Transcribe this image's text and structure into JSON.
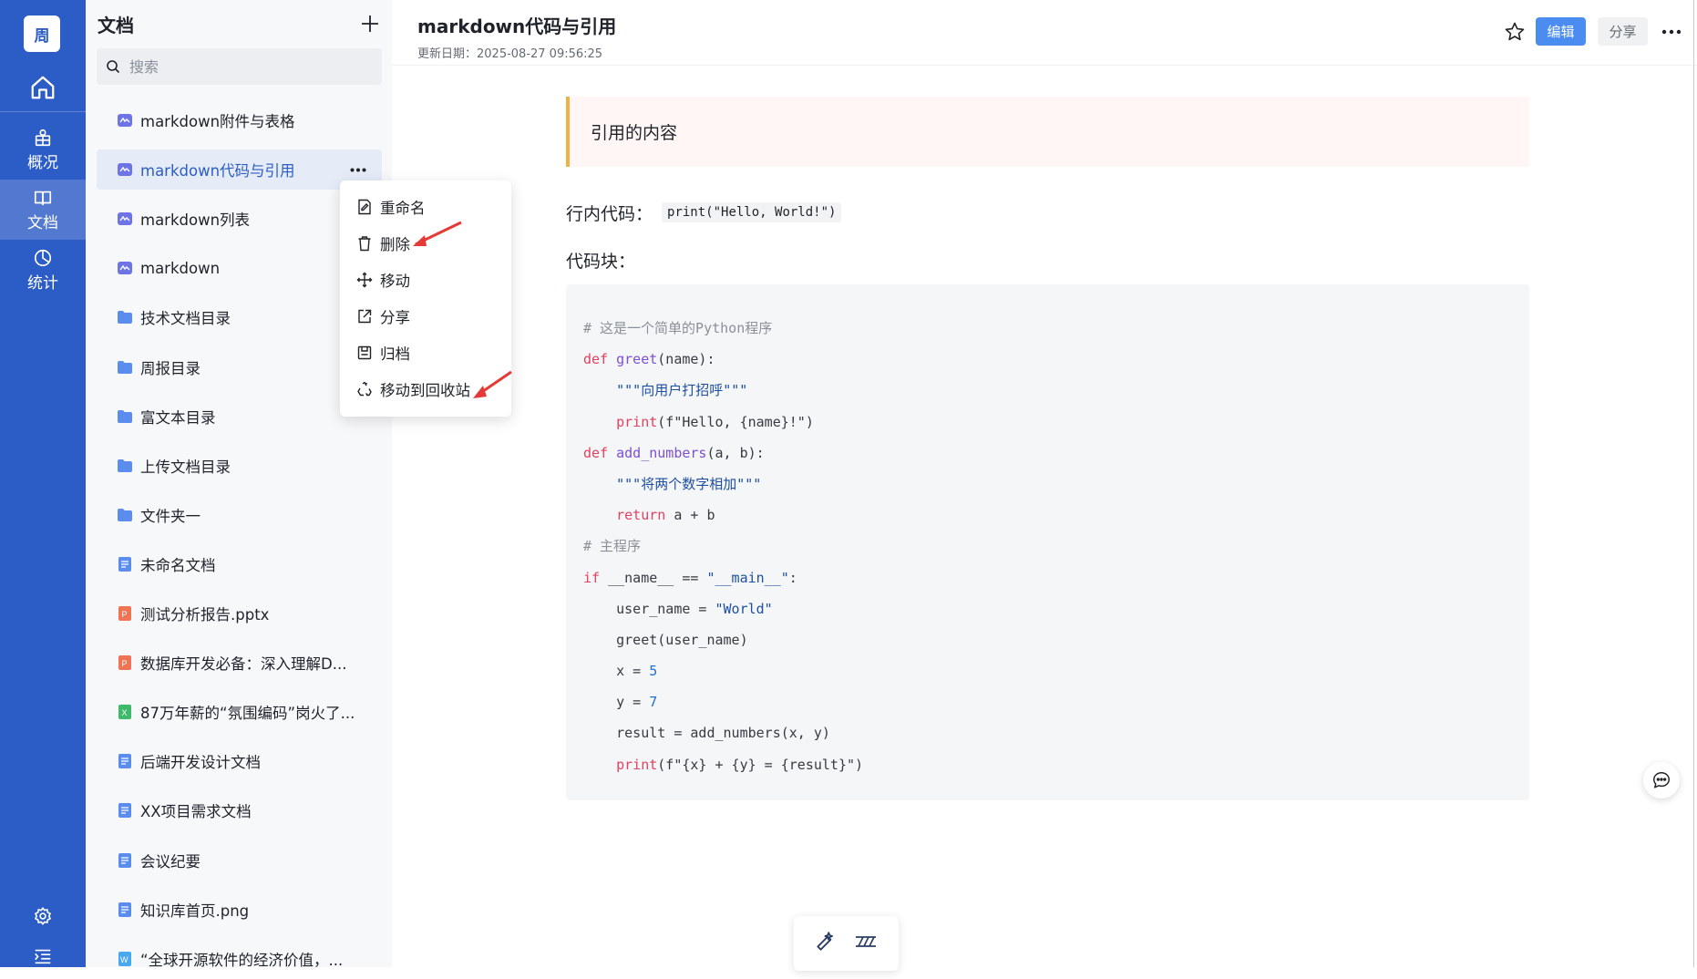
{
  "rail": {
    "avatar": "周",
    "items": [
      {
        "label": "概况"
      },
      {
        "label": "文档"
      },
      {
        "label": "统计"
      }
    ]
  },
  "sidebar": {
    "title": "文档",
    "search_placeholder": "搜索",
    "items": [
      {
        "label": "markdown附件与表格",
        "icon": "markdown-doc-icon"
      },
      {
        "label": "markdown代码与引用",
        "icon": "markdown-doc-icon"
      },
      {
        "label": "markdown列表",
        "icon": "markdown-doc-icon"
      },
      {
        "label": "markdown",
        "icon": "markdown-doc-icon"
      },
      {
        "label": "技术文档目录",
        "icon": "folder-icon"
      },
      {
        "label": "周报目录",
        "icon": "folder-icon"
      },
      {
        "label": "富文本目录",
        "icon": "folder-icon"
      },
      {
        "label": "上传文档目录",
        "icon": "folder-icon"
      },
      {
        "label": "文件夹一",
        "icon": "folder-icon"
      },
      {
        "label": "未命名文档",
        "icon": "doc-icon"
      },
      {
        "label": "测试分析报告.pptx",
        "icon": "ppt-icon"
      },
      {
        "label": "数据库开发必备：深入理解D...",
        "icon": "ppt-icon"
      },
      {
        "label": "87万年薪的“氛围编码”岗火了...",
        "icon": "excel-icon"
      },
      {
        "label": "后端开发设计文档",
        "icon": "doc-icon"
      },
      {
        "label": "XX项目需求文档",
        "icon": "doc-icon"
      },
      {
        "label": "会议纪要",
        "icon": "doc-icon"
      },
      {
        "label": "知识库首页.png",
        "icon": "doc-icon"
      },
      {
        "label": "“全球开源软件的经济价值，...",
        "icon": "word-icon"
      }
    ]
  },
  "context_menu": {
    "items": [
      {
        "label": "重命名",
        "icon": "rename-icon"
      },
      {
        "label": "删除",
        "icon": "trash-icon"
      },
      {
        "label": "移动",
        "icon": "move-icon"
      },
      {
        "label": "分享",
        "icon": "share-icon"
      },
      {
        "label": "归档",
        "icon": "archive-icon"
      },
      {
        "label": "移动到回收站",
        "icon": "recycle-icon"
      }
    ]
  },
  "header": {
    "title": "markdown代码与引用",
    "date": "更新日期：2025-08-27 09:56:25",
    "edit_label": "编辑",
    "share_label": "分享"
  },
  "content": {
    "quote": "引用的内容",
    "inline_label": "行内代码：",
    "inline_code": "print(\"Hello, World!\")",
    "block_label": "代码块：",
    "code_lines": [
      [
        {
          "t": "# 这是一个简单的Python程序",
          "c": "cm"
        }
      ],
      [
        {
          "t": "def ",
          "c": "kw"
        },
        {
          "t": "greet",
          "c": "fn"
        },
        {
          "t": "(name):",
          "c": ""
        }
      ],
      [
        {
          "t": "    \"\"\"向用户打招呼\"\"\"",
          "c": "st"
        }
      ],
      [
        {
          "t": "    ",
          "c": ""
        },
        {
          "t": "print",
          "c": "kw"
        },
        {
          "t": "(f\"Hello, {name}!\")",
          "c": ""
        }
      ],
      [
        {
          "t": "def ",
          "c": "kw"
        },
        {
          "t": "add_numbers",
          "c": "fn"
        },
        {
          "t": "(a, b):",
          "c": ""
        }
      ],
      [
        {
          "t": "    \"\"\"将两个数字相加\"\"\"",
          "c": "st"
        }
      ],
      [
        {
          "t": "    ",
          "c": ""
        },
        {
          "t": "return",
          "c": "kw"
        },
        {
          "t": " a + b",
          "c": ""
        }
      ],
      [
        {
          "t": "# 主程序",
          "c": "cm"
        }
      ],
      [
        {
          "t": "if",
          "c": "kw"
        },
        {
          "t": " __name__ == ",
          "c": ""
        },
        {
          "t": "\"__main__\"",
          "c": "st"
        },
        {
          "t": ":",
          "c": ""
        }
      ],
      [
        {
          "t": "    user_name = ",
          "c": ""
        },
        {
          "t": "\"World\"",
          "c": "st"
        }
      ],
      [
        {
          "t": "    greet(user_name)",
          "c": ""
        }
      ],
      [
        {
          "t": "    x = ",
          "c": ""
        },
        {
          "t": "5",
          "c": "nm"
        }
      ],
      [
        {
          "t": "    y = ",
          "c": ""
        },
        {
          "t": "7",
          "c": "nm"
        }
      ],
      [
        {
          "t": "    result = add_numbers(x, y)",
          "c": ""
        }
      ],
      [
        {
          "t": "    ",
          "c": ""
        },
        {
          "t": "print",
          "c": "kw"
        },
        {
          "t": "(f\"{x} + {y} = {result}\")",
          "c": ""
        }
      ]
    ]
  },
  "colors": {
    "rail": "#2c5cc5",
    "accent": "#4a8cf0",
    "quote_border": "#f0b143",
    "annotation_arrow": "#e53935"
  }
}
